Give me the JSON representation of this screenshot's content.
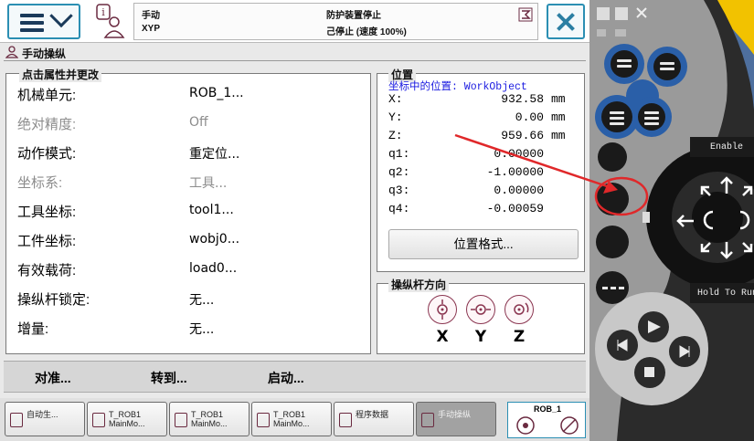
{
  "header": {
    "mode": "手动",
    "device": "XYP",
    "safety": "防护装置停止",
    "state": "己停止 (速度 100%)"
  },
  "page": {
    "title": "手动操纵"
  },
  "props": {
    "title": "点击属性并更改",
    "rows": [
      {
        "label": "机械单元:",
        "value": "ROB_1...",
        "disabled": false
      },
      {
        "label": "绝对精度:",
        "value": "Off",
        "disabled": true
      },
      {
        "label": "动作模式:",
        "value": "重定位...",
        "disabled": false
      },
      {
        "label": "坐标系:",
        "value": "工具...",
        "disabled": true
      },
      {
        "label": "工具坐标:",
        "value": "tool1...",
        "disabled": false
      },
      {
        "label": "工件坐标:",
        "value": "wobj0...",
        "disabled": false
      },
      {
        "label": "有效载荷:",
        "value": "load0...",
        "disabled": false
      },
      {
        "label": "操纵杆锁定:",
        "value": "无...",
        "disabled": false
      },
      {
        "label": "增量:",
        "value": "无...",
        "disabled": false
      }
    ]
  },
  "position": {
    "title": "位置",
    "header": "坐标中的位置: WorkObject",
    "rows": [
      {
        "name": "X:",
        "value": "932.58",
        "unit": "mm"
      },
      {
        "name": "Y:",
        "value": "0.00",
        "unit": "mm"
      },
      {
        "name": "Z:",
        "value": "959.66",
        "unit": "mm"
      },
      {
        "name": "q1:",
        "value": "0.00000",
        "unit": ""
      },
      {
        "name": "q2:",
        "value": "-1.00000",
        "unit": ""
      },
      {
        "name": "q3:",
        "value": "0.00000",
        "unit": ""
      },
      {
        "name": "q4:",
        "value": "-0.00059",
        "unit": ""
      }
    ],
    "format_button": "位置格式..."
  },
  "joystick": {
    "title": "操纵杆方向",
    "axes": [
      "X",
      "Y",
      "Z"
    ]
  },
  "commands": {
    "align": "对准...",
    "goto": "转到...",
    "start": "启动..."
  },
  "taskbar": {
    "items": [
      {
        "line1": "自动生...",
        "line2": ""
      },
      {
        "line1": "T_ROB1",
        "line2": "MainMo..."
      },
      {
        "line1": "T_ROB1",
        "line2": "MainMo..."
      },
      {
        "line1": "T_ROB1",
        "line2": "MainMo..."
      },
      {
        "line1": "程序数据",
        "line2": ""
      },
      {
        "line1": "手动操纵",
        "line2": ""
      }
    ],
    "robot": "ROB_1"
  },
  "flexpendant": {
    "enable": "Enable",
    "hold": "Hold To Run"
  },
  "colors": {
    "accent": "#2b8fb3",
    "annotation": "#e0282a",
    "link": "#1a1ae0"
  }
}
